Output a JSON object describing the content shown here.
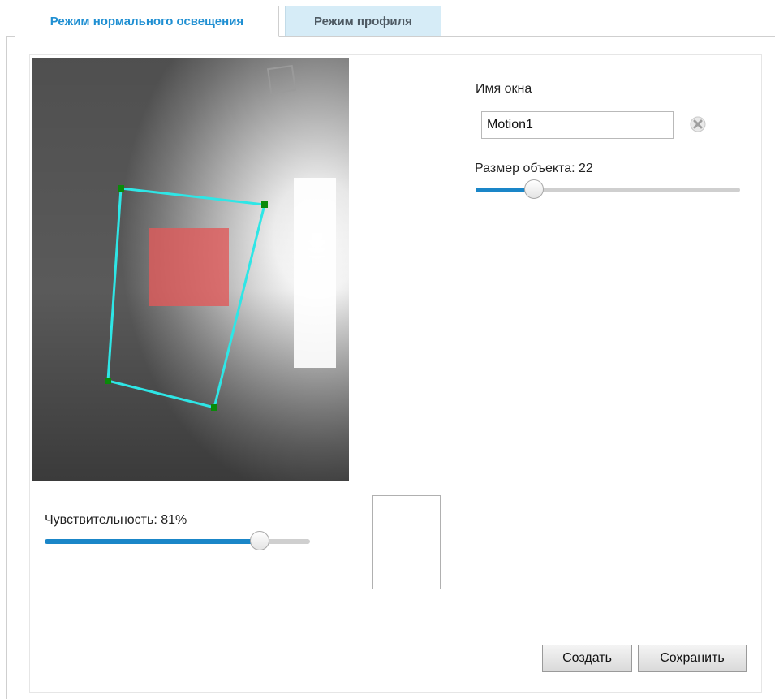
{
  "tabs": [
    {
      "label": "Режим нормального освещения",
      "active": true
    },
    {
      "label": "Режим профиля",
      "active": false
    }
  ],
  "window_name": {
    "label": "Имя окна",
    "value": "Motion1"
  },
  "object_size": {
    "label": "Размер объекта: 22",
    "value_percent": 22
  },
  "sensitivity": {
    "label": "Чувствительность: 81%",
    "value_percent": 81
  },
  "buttons": {
    "create": "Создать",
    "save": "Сохранить"
  },
  "colors": {
    "accent": "#1a86c8",
    "tab_active_text": "#1f8fd2",
    "tab_inactive_bg": "#d6ecf7",
    "window_outline": "#2ee6e6",
    "window_handle": "#0a8a0a",
    "object_size_indicator": "#e05a5a"
  },
  "icons": {
    "clear": "close-x-icon"
  }
}
